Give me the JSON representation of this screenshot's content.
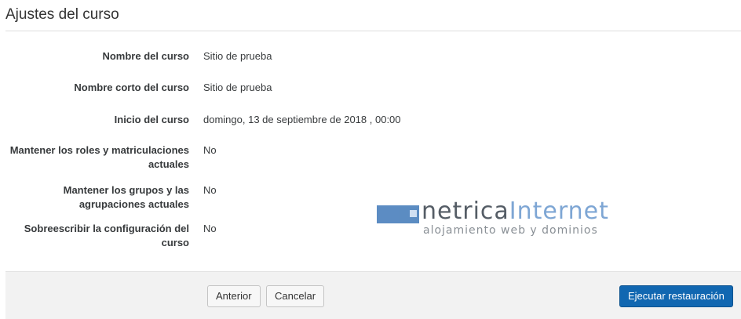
{
  "section": {
    "title": "Ajustes del curso"
  },
  "settings": [
    {
      "label": "Nombre del curso",
      "value": "Sitio de prueba"
    },
    {
      "label": "Nombre corto del curso",
      "value": "Sitio de prueba"
    },
    {
      "label": "Inicio del curso",
      "value": "domingo, 13 de septiembre de 2018 , 00:00"
    },
    {
      "label": "Mantener los roles y matriculaciones actuales",
      "value": "No"
    },
    {
      "label": "Mantener los grupos y las agrupaciones actuales",
      "value": "No"
    },
    {
      "label": "Sobreescribir la configuración del curso",
      "value": "No"
    }
  ],
  "watermark": {
    "brand_dark": "netrica",
    "brand_light": "Internet",
    "tagline": "alojamiento web y dominios"
  },
  "footer": {
    "previous_label": "Anterior",
    "cancel_label": "Cancelar",
    "execute_label": "Ejecutar restauración"
  },
  "colors": {
    "primary_button": "#1167b1",
    "footer_background": "#f2f2f2",
    "watermark_accent": "#3f78b8"
  }
}
